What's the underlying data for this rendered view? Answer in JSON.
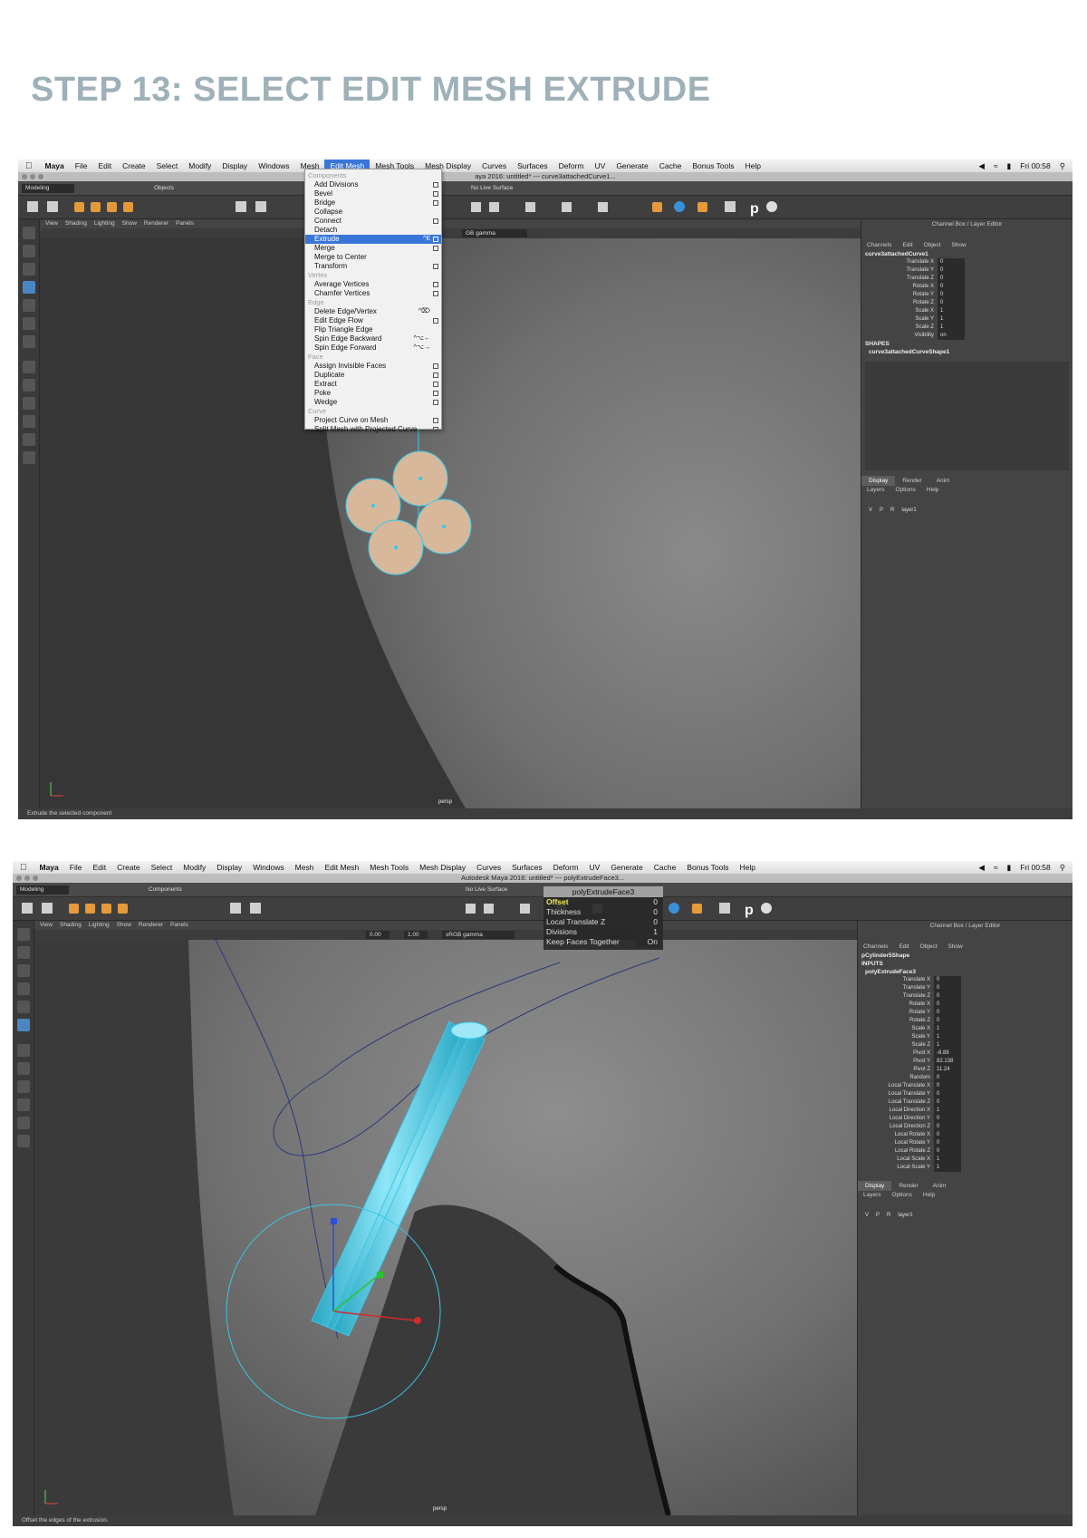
{
  "step_title": "STEP 13:  SELECT EDIT MESH EXTRUDE",
  "shot1": {
    "menubar": {
      "apple": "",
      "items": [
        "Maya",
        "File",
        "Edit",
        "Create",
        "Select",
        "Modify",
        "Display",
        "Windows",
        "Mesh",
        "Edit Mesh",
        "Mesh Tools",
        "Mesh Display",
        "Curves",
        "Surfaces",
        "Deform",
        "UV",
        "Generate",
        "Cache",
        "Bonus Tools",
        "Help"
      ],
      "active": "Edit Mesh",
      "clock": "Fri 00:58"
    },
    "window_title": "aya 2016: untitled*   ---   curve3attachedCurve1...",
    "mode_selector": "Modeling",
    "objects_label": "Objects",
    "no_live_surface": "No Live Surface",
    "viewport_menu": [
      "View",
      "Shading",
      "Lighting",
      "Show",
      "Renderer",
      "Panels"
    ],
    "gamma_label": "GB gamma",
    "camera_label": "persp",
    "help_line": "Extrude the selected component",
    "edit_mesh_menu": [
      {
        "type": "header",
        "label": "Components"
      },
      {
        "type": "item",
        "label": "Add Divisions",
        "box": true
      },
      {
        "type": "item",
        "label": "Bevel",
        "box": true
      },
      {
        "type": "item",
        "label": "Bridge",
        "box": true
      },
      {
        "type": "item",
        "label": "Collapse"
      },
      {
        "type": "item",
        "label": "Connect",
        "box": true
      },
      {
        "type": "item",
        "label": "Detach"
      },
      {
        "type": "item",
        "label": "Extrude",
        "shortcut": "^E",
        "box": true,
        "highlighted": true
      },
      {
        "type": "item",
        "label": "Merge",
        "box": true
      },
      {
        "type": "item",
        "label": "Merge to Center"
      },
      {
        "type": "item",
        "label": "Transform",
        "box": true
      },
      {
        "type": "header",
        "label": "Vertex"
      },
      {
        "type": "item",
        "label": "Average Vertices",
        "box": true
      },
      {
        "type": "item",
        "label": "Chamfer Vertices",
        "box": true
      },
      {
        "type": "header",
        "label": "Edge"
      },
      {
        "type": "item",
        "label": "Delete Edge/Vertex",
        "shortcut": "^⌦"
      },
      {
        "type": "item",
        "label": "Edit Edge Flow",
        "box": true
      },
      {
        "type": "item",
        "label": "Flip Triangle Edge"
      },
      {
        "type": "item",
        "label": "Spin Edge Backward",
        "shortcut": "^⌥←"
      },
      {
        "type": "item",
        "label": "Spin Edge Forward",
        "shortcut": "^⌥→"
      },
      {
        "type": "header",
        "label": "Face"
      },
      {
        "type": "item",
        "label": "Assign Invisible Faces",
        "box": true
      },
      {
        "type": "item",
        "label": "Duplicate",
        "box": true
      },
      {
        "type": "item",
        "label": "Extract",
        "box": true
      },
      {
        "type": "item",
        "label": "Poke",
        "box": true
      },
      {
        "type": "item",
        "label": "Wedge",
        "box": true
      },
      {
        "type": "header",
        "label": "Curve"
      },
      {
        "type": "item",
        "label": "Project Curve on Mesh",
        "box": true
      },
      {
        "type": "item",
        "label": "Split Mesh with Projected Curve",
        "box": true
      }
    ],
    "channel_box": {
      "title": "Channel Box / Layer Editor",
      "tabs": [
        "Channels",
        "Edit",
        "Object",
        "Show"
      ],
      "node": "curve3attachedCurve1",
      "channels": [
        {
          "label": "Translate X",
          "value": "0"
        },
        {
          "label": "Translate Y",
          "value": "0"
        },
        {
          "label": "Translate Z",
          "value": "0"
        },
        {
          "label": "Rotate X",
          "value": "0"
        },
        {
          "label": "Rotate Y",
          "value": "0"
        },
        {
          "label": "Rotate Z",
          "value": "0"
        },
        {
          "label": "Scale X",
          "value": "1"
        },
        {
          "label": "Scale Y",
          "value": "1"
        },
        {
          "label": "Scale Z",
          "value": "1"
        },
        {
          "label": "Visibility",
          "value": "on"
        }
      ],
      "shapes_header": "SHAPES",
      "shape_node": "curve3attachedCurveShape1",
      "display_tabs": [
        "Display",
        "Render",
        "Anim"
      ],
      "layer_menu": [
        "Layers",
        "Options",
        "Help"
      ],
      "layer": {
        "v": "V",
        "p": "P",
        "r": "R",
        "name": "layer1"
      }
    }
  },
  "shot2": {
    "menubar": {
      "items": [
        "Maya",
        "File",
        "Edit",
        "Create",
        "Select",
        "Modify",
        "Display",
        "Windows",
        "Mesh",
        "Edit Mesh",
        "Mesh Tools",
        "Mesh Display",
        "Curves",
        "Surfaces",
        "Deform",
        "UV",
        "Generate",
        "Cache",
        "Bonus Tools",
        "Help"
      ],
      "clock": "Fri 00:58"
    },
    "window_title": "Autodesk Maya 2016: untitled*   ---   polyExtrudeFace3...",
    "mode_selector": "Modeling",
    "components_label": "Components",
    "no_live_surface": "No Live Surface",
    "viewport_menu": [
      "View",
      "Shading",
      "Lighting",
      "Show",
      "Renderer",
      "Panels"
    ],
    "exposure": "0.00",
    "gamma_value": "1.00",
    "gamma_label": "sRGB gamma",
    "camera_label": "persp",
    "help_line": "Offset the edges of the extrusion.",
    "hud": {
      "title": "polyExtrudeFace3",
      "rows": [
        {
          "label": "Offset",
          "value": "0",
          "highlight": true
        },
        {
          "label": "Thickness",
          "value": "0"
        },
        {
          "label": "Local Translate Z",
          "value": "0"
        },
        {
          "label": "Divisions",
          "value": "1"
        },
        {
          "label": "Keep Faces Together",
          "value": "On"
        }
      ]
    },
    "channel_box": {
      "title": "Channel Box / Layer Editor",
      "tabs": [
        "Channels",
        "Edit",
        "Object",
        "Show"
      ],
      "shape_node": "pCylinder5Shape",
      "inputs_header": "INPUTS",
      "input_node": "polyExtrudeFace3",
      "channels": [
        {
          "label": "Translate X",
          "value": "0"
        },
        {
          "label": "Translate Y",
          "value": "0"
        },
        {
          "label": "Translate Z",
          "value": "0"
        },
        {
          "label": "Rotate X",
          "value": "0"
        },
        {
          "label": "Rotate Y",
          "value": "0"
        },
        {
          "label": "Rotate Z",
          "value": "0"
        },
        {
          "label": "Scale X",
          "value": "1"
        },
        {
          "label": "Scale Y",
          "value": "1"
        },
        {
          "label": "Scale Z",
          "value": "1"
        },
        {
          "label": "Pivot X",
          "value": "-8.88"
        },
        {
          "label": "Pivot Y",
          "value": "82.138"
        },
        {
          "label": "Pivot Z",
          "value": "11.24"
        },
        {
          "label": "Random",
          "value": "0"
        },
        {
          "label": "Local Translate X",
          "value": "0"
        },
        {
          "label": "Local Translate Y",
          "value": "0"
        },
        {
          "label": "Local Translate Z",
          "value": "0"
        },
        {
          "label": "Local Direction X",
          "value": "1"
        },
        {
          "label": "Local Direction Y",
          "value": "0"
        },
        {
          "label": "Local Direction Z",
          "value": "0"
        },
        {
          "label": "Local Rotate X",
          "value": "0"
        },
        {
          "label": "Local Rotate Y",
          "value": "0"
        },
        {
          "label": "Local Rotate Z",
          "value": "0"
        },
        {
          "label": "Local Scale X",
          "value": "1"
        },
        {
          "label": "Local Scale Y",
          "value": "1"
        }
      ],
      "display_tabs": [
        "Display",
        "Render",
        "Anim"
      ],
      "layer_menu": [
        "Layers",
        "Options",
        "Help"
      ],
      "layer": {
        "v": "V",
        "p": "P",
        "r": "R",
        "name": "layer1"
      }
    }
  },
  "colors": {
    "title_color": "#9fb1b8",
    "menu_highlight": "#3a76d8",
    "selection_cyan": "#39c8e8",
    "hud_offset_yellow": "#f4e85a"
  },
  "icons": [
    "apple-icon",
    "wifi-icon",
    "volume-icon",
    "battery-icon",
    "search-icon",
    "select-tool-icon",
    "lasso-tool-icon",
    "paint-tool-icon",
    "move-tool-icon",
    "rotate-tool-icon",
    "scale-tool-icon",
    "maya-logo-icon"
  ]
}
